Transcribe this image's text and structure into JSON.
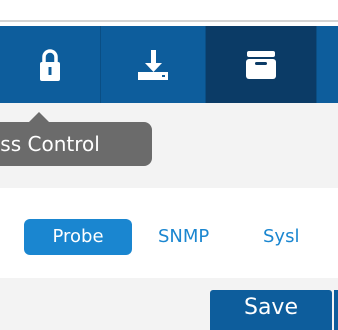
{
  "toolbar": {
    "items": [
      {
        "icon": "lock-icon",
        "active": false
      },
      {
        "icon": "download-icon",
        "active": false
      },
      {
        "icon": "archive-icon",
        "active": true
      }
    ],
    "bg_color": "#0d5d9c",
    "active_color": "#0b3b66"
  },
  "tooltip": {
    "text": "ess Control"
  },
  "tabs": {
    "items": [
      {
        "label": "Probe",
        "active": true
      },
      {
        "label": "SNMP",
        "active": false
      },
      {
        "label": "Sysl",
        "active": false
      }
    ],
    "accent": "#1a86d0"
  },
  "actions": {
    "save_label": "Save"
  }
}
